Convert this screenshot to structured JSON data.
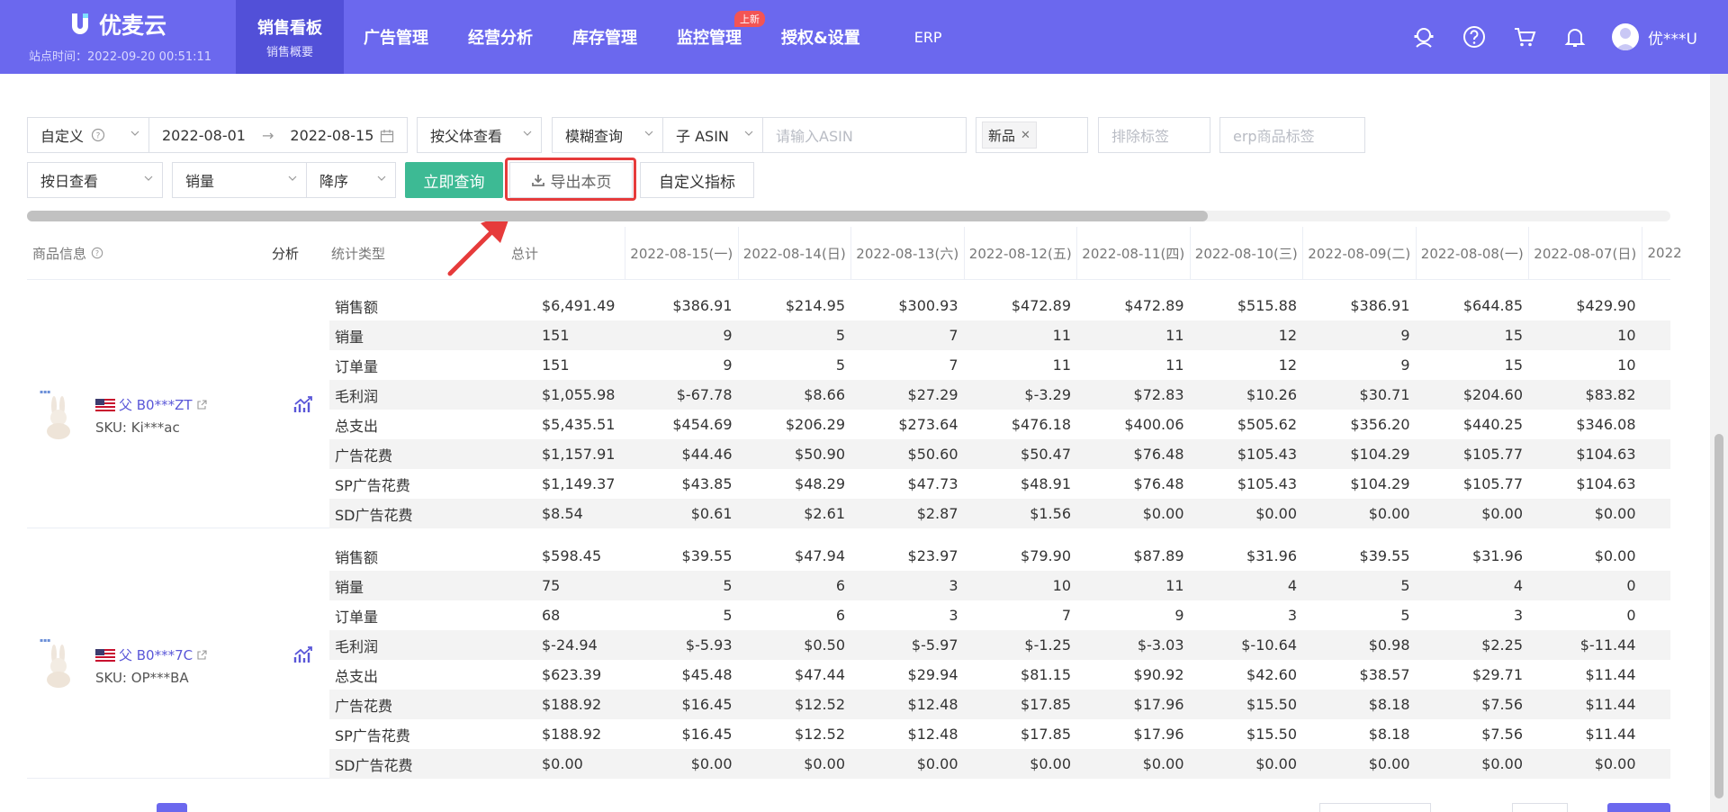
{
  "app": {
    "name": "优麦云",
    "site_time": "站点时间：2022-09-20 00:51:11"
  },
  "nav": {
    "items": [
      {
        "label": "销售看板",
        "sub": "销售概要"
      },
      {
        "label": "广告管理"
      },
      {
        "label": "经营分析"
      },
      {
        "label": "库存管理"
      },
      {
        "label": "监控管理",
        "badge": "上新"
      },
      {
        "label": "授权&设置"
      },
      {
        "label": "ERP"
      }
    ],
    "user": "优***U",
    "icons": [
      "support-icon",
      "help-icon",
      "cart-icon",
      "bell-icon",
      "user-avatar-icon"
    ]
  },
  "filters": {
    "date_mode": "自定义",
    "start_date": "2022-08-01",
    "end_date": "2022-08-15",
    "view_by": "按父体查看",
    "match_mode": "模糊查询",
    "asin_type": "子 ASIN",
    "asin_placeholder": "请输入ASIN",
    "tag": "新品",
    "exclude_placeholder": "排除标签",
    "erp_placeholder": "erp商品标签",
    "granularity": "按日查看",
    "sort_field": "销量",
    "sort_order": "降序",
    "query_button": "立即查询",
    "export_button": "导出本页",
    "custom_metric_button": "自定义指标"
  },
  "table": {
    "headers": {
      "product": "商品信息",
      "analysis": "分析",
      "stat_type": "统计类型",
      "total": "总计"
    },
    "dates": [
      "2022-08-15(一)",
      "2022-08-14(日)",
      "2022-08-13(六)",
      "2022-08-12(五)",
      "2022-08-11(四)",
      "2022-08-10(三)",
      "2022-08-09(二)",
      "2022-08-08(一)",
      "2022-08-07(日)",
      "2022"
    ],
    "groups": [
      {
        "asin": "父 B0***ZT",
        "sku": "SKU: Ki***ac",
        "rows": [
          {
            "type": "销售额",
            "total": "$6,491.49",
            "values": [
              "$386.91",
              "$214.95",
              "$300.93",
              "$472.89",
              "$472.89",
              "$515.88",
              "$386.91",
              "$644.85",
              "$429.90"
            ]
          },
          {
            "type": "销量",
            "total": "151",
            "values": [
              "9",
              "5",
              "7",
              "11",
              "11",
              "12",
              "9",
              "15",
              "10"
            ]
          },
          {
            "type": "订单量",
            "total": "151",
            "values": [
              "9",
              "5",
              "7",
              "11",
              "11",
              "12",
              "9",
              "15",
              "10"
            ]
          },
          {
            "type": "毛利润",
            "total": "$1,055.98",
            "values": [
              "$-67.78",
              "$8.66",
              "$27.29",
              "$-3.29",
              "$72.83",
              "$10.26",
              "$30.71",
              "$204.60",
              "$83.82"
            ]
          },
          {
            "type": "总支出",
            "total": "$5,435.51",
            "values": [
              "$454.69",
              "$206.29",
              "$273.64",
              "$476.18",
              "$400.06",
              "$505.62",
              "$356.20",
              "$440.25",
              "$346.08"
            ]
          },
          {
            "type": "广告花费",
            "total": "$1,157.91",
            "values": [
              "$44.46",
              "$50.90",
              "$50.60",
              "$50.47",
              "$76.48",
              "$105.43",
              "$104.29",
              "$105.77",
              "$104.63"
            ]
          },
          {
            "type": "SP广告花费",
            "total": "$1,149.37",
            "values": [
              "$43.85",
              "$48.29",
              "$47.73",
              "$48.91",
              "$76.48",
              "$105.43",
              "$104.29",
              "$105.77",
              "$104.63"
            ]
          },
          {
            "type": "SD广告花费",
            "total": "$8.54",
            "values": [
              "$0.61",
              "$2.61",
              "$2.87",
              "$1.56",
              "$0.00",
              "$0.00",
              "$0.00",
              "$0.00",
              "$0.00"
            ]
          }
        ]
      },
      {
        "asin": "父 B0***7C",
        "sku": "SKU: OP***BA",
        "rows": [
          {
            "type": "销售额",
            "total": "$598.45",
            "values": [
              "$39.55",
              "$47.94",
              "$23.97",
              "$79.90",
              "$87.89",
              "$31.96",
              "$39.55",
              "$31.96",
              "$0.00"
            ]
          },
          {
            "type": "销量",
            "total": "75",
            "values": [
              "5",
              "6",
              "3",
              "10",
              "11",
              "4",
              "5",
              "4",
              "0"
            ]
          },
          {
            "type": "订单量",
            "total": "68",
            "values": [
              "5",
              "6",
              "3",
              "7",
              "9",
              "3",
              "5",
              "3",
              "0"
            ]
          },
          {
            "type": "毛利润",
            "total": "$-24.94",
            "values": [
              "$-5.93",
              "$0.50",
              "$-5.97",
              "$-1.25",
              "$-3.03",
              "$-10.64",
              "$0.98",
              "$2.25",
              "$-11.44"
            ]
          },
          {
            "type": "总支出",
            "total": "$623.39",
            "values": [
              "$45.48",
              "$47.44",
              "$29.94",
              "$81.15",
              "$90.92",
              "$42.60",
              "$38.57",
              "$29.71",
              "$11.44"
            ]
          },
          {
            "type": "广告花费",
            "total": "$188.92",
            "values": [
              "$16.45",
              "$12.52",
              "$12.48",
              "$17.85",
              "$17.96",
              "$15.50",
              "$8.18",
              "$7.56",
              "$11.44"
            ]
          },
          {
            "type": "SP广告花费",
            "total": "$188.92",
            "values": [
              "$16.45",
              "$12.52",
              "$12.48",
              "$17.85",
              "$17.96",
              "$15.50",
              "$8.18",
              "$7.56",
              "$11.44"
            ]
          },
          {
            "type": "SD广告花费",
            "total": "$0.00",
            "values": [
              "$0.00",
              "$0.00",
              "$0.00",
              "$0.00",
              "$0.00",
              "$0.00",
              "$0.00",
              "$0.00",
              "$0.00"
            ]
          }
        ]
      }
    ]
  },
  "colors": {
    "topbar": "#6b68ee",
    "active_nav": "#5250d8",
    "primary_button": "#3dba94",
    "highlight": "#e63b3b",
    "link": "#5a57d8"
  }
}
